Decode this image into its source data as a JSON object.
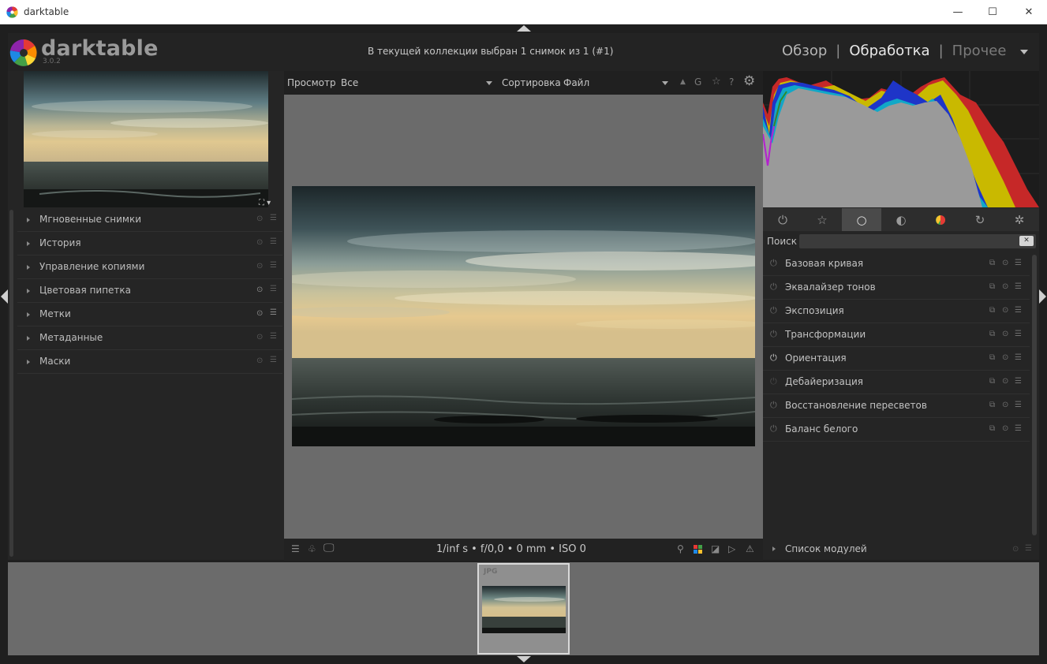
{
  "window": {
    "title": "darktable",
    "minimize": "—",
    "maximize": "☐",
    "close": "✕"
  },
  "header": {
    "brand_name": "darktable",
    "version": "3.0.2",
    "collection_info": "В текущей коллекции выбран 1 снимок из 1 (#1)",
    "views": {
      "lighttable": "Обзор",
      "separator": "|",
      "darkroom": "Обработка",
      "other": "Прочее"
    }
  },
  "left_panel": {
    "modules": [
      {
        "label": "Мгновенные снимки"
      },
      {
        "label": "История"
      },
      {
        "label": "Управление копиями"
      },
      {
        "label": "Цветовая пипетка"
      },
      {
        "label": "Метки"
      },
      {
        "label": "Метаданные"
      },
      {
        "label": "Маски"
      }
    ]
  },
  "center_top": {
    "view_label": "Просмотр",
    "view_value": "Все",
    "sort_label": "Сортировка",
    "sort_value": "Файл",
    "grouping": "G"
  },
  "center_bottom": {
    "exif": "1/inf s • f/0,0 • 0 mm • ISO 0"
  },
  "right_panel": {
    "search_label": "Поиск",
    "modules": [
      {
        "label": "Базовая кривая",
        "on": false
      },
      {
        "label": "Эквалайзер тонов",
        "on": false
      },
      {
        "label": "Экспозиция",
        "on": false
      },
      {
        "label": "Трансформации",
        "on": false
      },
      {
        "label": "Ориентация",
        "on": true
      },
      {
        "label": "Дебайеризация",
        "on": false
      },
      {
        "label": "Восстановление пересветов",
        "on": false
      },
      {
        "label": "Баланс белого",
        "on": false
      }
    ],
    "module_list_label": "Список модулей"
  },
  "filmstrip": {
    "format_tag": "JPG"
  },
  "colors": {
    "panel_bg": "#252525",
    "canvas_bg": "#6b6b6b",
    "text": "#c2c2c2",
    "accent_active": "#e8e8e8"
  }
}
